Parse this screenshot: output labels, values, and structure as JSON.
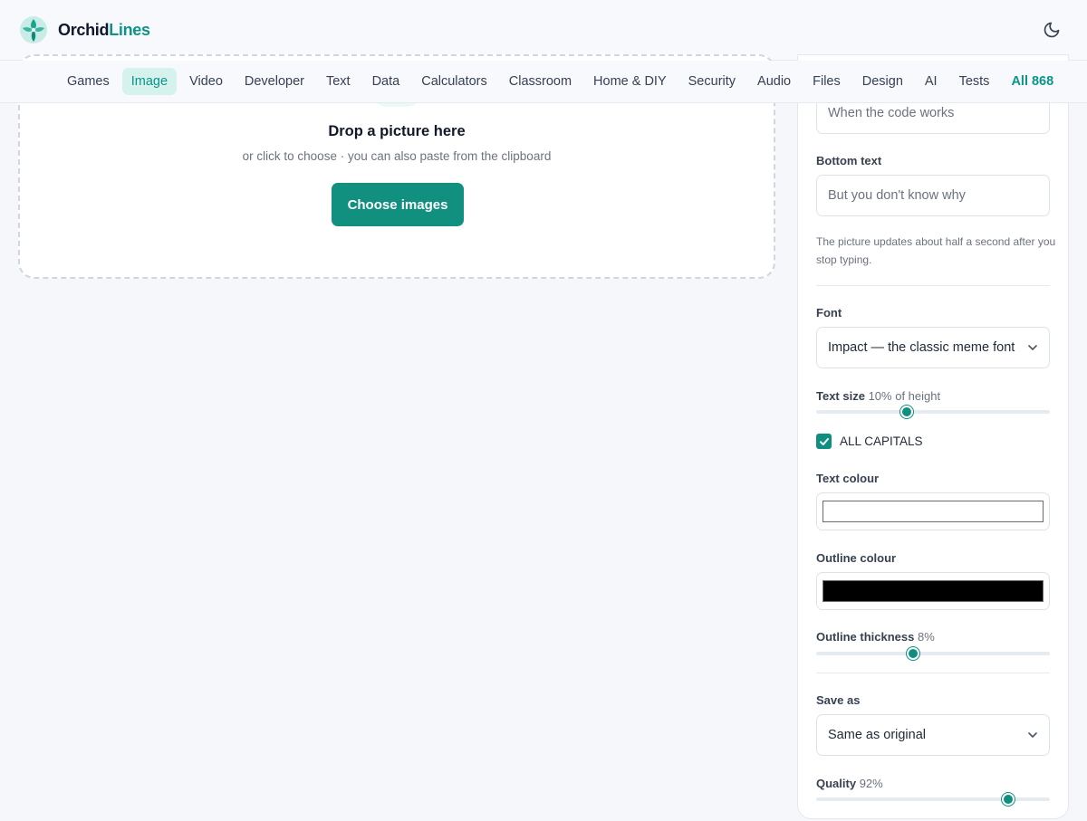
{
  "brand": {
    "name_part1": "Orchid",
    "name_part2": "Lines"
  },
  "header": {
    "theme_icon": "moon-icon"
  },
  "nav": {
    "items": [
      {
        "label": "Games"
      },
      {
        "label": "Image"
      },
      {
        "label": "Video"
      },
      {
        "label": "Developer"
      },
      {
        "label": "Text"
      },
      {
        "label": "Data"
      },
      {
        "label": "Calculators"
      },
      {
        "label": "Classroom"
      },
      {
        "label": "Home & DIY"
      },
      {
        "label": "Security"
      },
      {
        "label": "Audio"
      },
      {
        "label": "Files"
      },
      {
        "label": "Design"
      },
      {
        "label": "AI"
      },
      {
        "label": "Tests"
      },
      {
        "label": "All 868"
      }
    ],
    "active": "Image"
  },
  "dropzone": {
    "title": "Drop a picture here",
    "subtitle": "or click to choose · you can also paste from the clipboard",
    "button_label": "Choose images"
  },
  "panel": {
    "top_text": {
      "placeholder": "When the code works"
    },
    "bottom_text": {
      "label": "Bottom text",
      "placeholder": "But you don't know why"
    },
    "hint": "The picture updates about half a second after you stop typing.",
    "font": {
      "label": "Font",
      "value": "Impact — the classic meme font"
    },
    "text_size": {
      "label": "Text size",
      "value_text": "10% of height",
      "slider_fraction": 0.38
    },
    "all_caps": {
      "label": "ALL CAPITALS",
      "checked": true
    },
    "text_colour": {
      "label": "Text colour",
      "value": "#ffffff"
    },
    "outline_colour": {
      "label": "Outline colour",
      "value": "#000000"
    },
    "outline_thickness": {
      "label": "Outline thickness",
      "value_text": "8%",
      "slider_fraction": 0.41
    },
    "save_as": {
      "label": "Save as",
      "value": "Same as original"
    },
    "quality": {
      "label": "Quality",
      "value_text": "92%",
      "slider_fraction": 0.84
    }
  },
  "colors": {
    "accent": "#0d9488",
    "button": "#11907f",
    "active_nav_bg": "#d5f2ec"
  }
}
